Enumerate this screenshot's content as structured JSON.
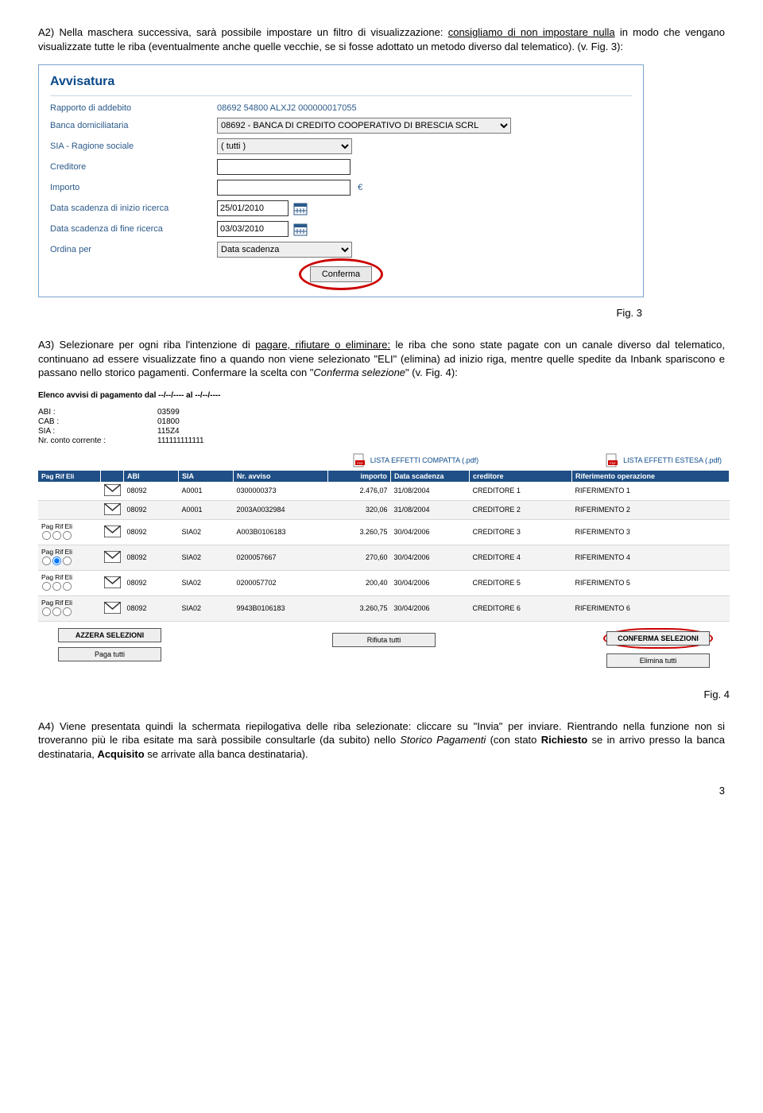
{
  "paraA2_a": "A2) Nella maschera successiva, sarà possibile impostare un filtro di visualizzazione: ",
  "paraA2_b": "consigliamo di non impostare nulla",
  "paraA2_c": " in modo che vengano visualizzate tutte le riba (eventualmente anche quelle vecchie, se si fosse adottato un metodo diverso dal telematico). (v. Fig. 3):",
  "fig3": {
    "title": "Avvisatura",
    "labels": {
      "rapporto": "Rapporto di addebito",
      "banca": "Banca domiciliataria",
      "sia": "SIA - Ragione sociale",
      "creditore": "Creditore",
      "importo": "Importo",
      "dataInizio": "Data scadenza di inizio ricerca",
      "dataFine": "Data scadenza di fine ricerca",
      "ordina": "Ordina per"
    },
    "values": {
      "rapporto": "08692 54800 ALXJ2 000000017055",
      "banca": "08692 - BANCA DI CREDITO COOPERATIVO DI BRESCIA SCRL",
      "sia": "( tutti )",
      "creditore": "",
      "importo": "",
      "dataInizio": "25/01/2010",
      "dataFine": "03/03/2010",
      "ordina": "Data scadenza"
    },
    "euro": "€",
    "conferma": "Conferma"
  },
  "fig3cap": "Fig. 3",
  "paraA3_a": "A3) Selezionare per ogni riba l'intenzione di ",
  "paraA3_b": "pagare, rifiutare o eliminare:",
  "paraA3_c": " le riba che sono state pagate con un canale diverso dal telematico, continuano ad essere visualizzate fino a quando non viene selezionato \"ELI\" (elimina) ad inizio riga, mentre quelle spedite da Inbank spariscono e passano nello storico pagamenti. Confermare la scelta con \"",
  "paraA3_d": "Conferma selezione",
  "paraA3_e": "\" (v. Fig. 4):",
  "fig4": {
    "elencoTitle": "Elenco avvisi di pagamento dal --/--/---- al --/--/----",
    "codes": {
      "abiL": "ABI :",
      "abiV": "03599",
      "cabL": "CAB :",
      "cabV": "01800",
      "siaL": "SIA :",
      "siaV": "115Z4",
      "ccL": "Nr. conto corrente :",
      "ccV": "111111111111"
    },
    "pdf1": "LISTA EFFETTI COMPATTA (.pdf)",
    "pdf2": "LISTA EFFETTI ESTESA (.pdf)",
    "headers": {
      "sel": "Pag  Rif  Eli",
      "abi": "ABI",
      "sia": "SIA",
      "nr": "Nr. avviso",
      "imp": "importo",
      "scad": "Data scadenza",
      "cred": "creditore",
      "rif": "Riferimento operazione"
    },
    "selLabels": {
      "pag": "Pag",
      "rif": "Rif",
      "eli": "Eli"
    },
    "rows": [
      {
        "abi": "08092",
        "sia": "A0001",
        "nr": "0300000373",
        "imp": "2.476,07",
        "scad": "31/08/2004",
        "cred": "CREDITORE 1",
        "rif": "RIFERIMENTO 1",
        "radios": false
      },
      {
        "abi": "08092",
        "sia": "A0001",
        "nr": "2003A0032984",
        "imp": "320,06",
        "scad": "31/08/2004",
        "cred": "CREDITORE 2",
        "rif": "RIFERIMENTO 2",
        "radios": false
      },
      {
        "abi": "08092",
        "sia": "SIA02",
        "nr": "A003B0106183",
        "imp": "3.260,75",
        "scad": "30/04/2006",
        "cred": "CREDITORE 3",
        "rif": "RIFERIMENTO 3",
        "radios": true
      },
      {
        "abi": "08092",
        "sia": "SIA02",
        "nr": "0200057667",
        "imp": "270,60",
        "scad": "30/04/2006",
        "cred": "CREDITORE 4",
        "rif": "RIFERIMENTO 4",
        "radios": true,
        "checked": 1
      },
      {
        "abi": "08092",
        "sia": "SIA02",
        "nr": "0200057702",
        "imp": "200,40",
        "scad": "30/04/2006",
        "cred": "CREDITORE 5",
        "rif": "RIFERIMENTO 5",
        "radios": true
      },
      {
        "abi": "08092",
        "sia": "SIA02",
        "nr": "9943B0106183",
        "imp": "3.260,75",
        "scad": "30/04/2006",
        "cred": "CREDITORE 6",
        "rif": "RIFERIMENTO 6",
        "radios": true
      }
    ],
    "btns": {
      "azzera": "AZZERA SELEZIONI",
      "conferma": "CONFERMA SELEZIONI",
      "paga": "Paga tutti",
      "rifiuta": "Rifiuta tutti",
      "elimina": "Elimina tutti"
    }
  },
  "fig4cap": "Fig. 4",
  "paraA4_a": "A4) Viene presentata quindi la schermata riepilogativa delle riba selezionate: cliccare su \"Invia\" per inviare. Rientrando nella funzione non si troveranno più le riba esitate ma sarà possibile consultarle (da subito) nello ",
  "paraA4_b": "Storico Pagamenti",
  "paraA4_c": " (con stato ",
  "paraA4_d": "Richiesto",
  "paraA4_e": " se in arrivo presso la banca destinataria, ",
  "paraA4_f": "Acquisito",
  "paraA4_g": " se arrivate alla banca destinataria).",
  "pagenum": "3"
}
